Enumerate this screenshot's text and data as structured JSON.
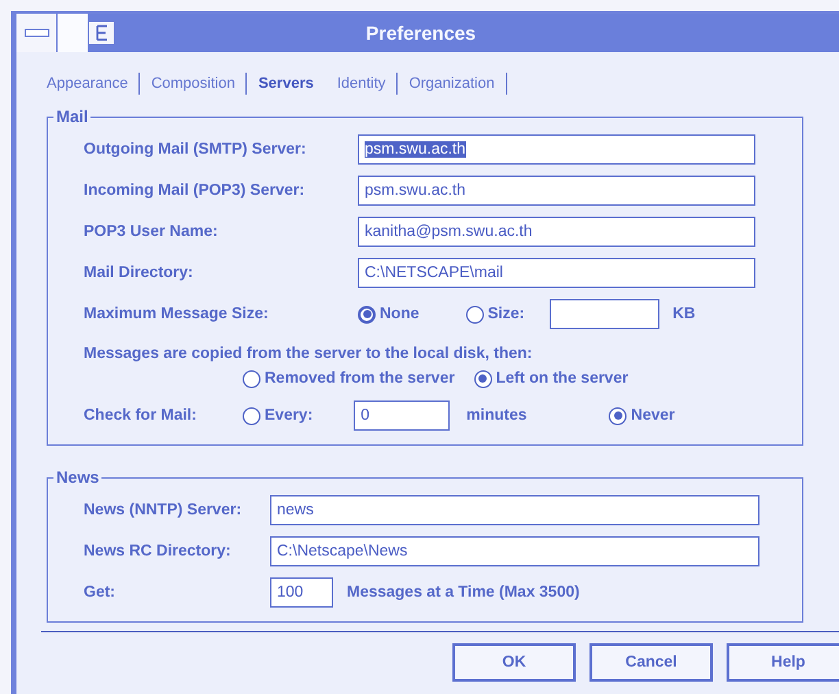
{
  "window": {
    "title": "Preferences"
  },
  "tabs": [
    {
      "label": "Appearance",
      "selected": false
    },
    {
      "label": "Composition",
      "selected": false
    },
    {
      "label": "Servers",
      "selected": true
    },
    {
      "label": "Identity",
      "selected": false
    },
    {
      "label": "Organization",
      "selected": false
    }
  ],
  "mail": {
    "title": "Mail",
    "fields": [
      {
        "label": "Outgoing Mail (SMTP) Server:",
        "value": "psm.swu.ac.th",
        "highlighted": true
      },
      {
        "label": "Incoming Mail (POP3) Server:",
        "value": "psm.swu.ac.th",
        "highlighted": false
      },
      {
        "label": "POP3 User Name:",
        "value": "kanitha@psm.swu.ac.th",
        "highlighted": false
      },
      {
        "label": "Mail Directory:",
        "value": "C:\\NETSCAPE\\mail",
        "highlighted": false
      }
    ],
    "max_size": {
      "label": "Maximum Message Size:",
      "options": [
        {
          "label": "None",
          "selected": true
        },
        {
          "label": "Size:",
          "selected": false
        }
      ],
      "unit": "KB"
    },
    "copy": {
      "text": "Messages are copied from the server to the local disk, then:",
      "options": [
        {
          "label": "Removed from the server",
          "selected": false
        },
        {
          "label": "Left on the server",
          "selected": true
        }
      ]
    },
    "check": {
      "label": "Check for Mail:",
      "options": [
        {
          "label": "Every:",
          "selected": false
        },
        {
          "label": "Never",
          "selected": true
        }
      ],
      "value": "0",
      "unit": "minutes"
    }
  },
  "news": {
    "title": "News",
    "fields": [
      {
        "label": "News (NNTP) Server:",
        "value": "news"
      },
      {
        "label": "News RC Directory:",
        "value": "C:\\Netscape\\News"
      }
    ],
    "get": {
      "label": "Get:",
      "value": "100",
      "text": "Messages at a Time (Max 3500)"
    }
  },
  "buttons": [
    "OK",
    "Cancel",
    "Help"
  ]
}
